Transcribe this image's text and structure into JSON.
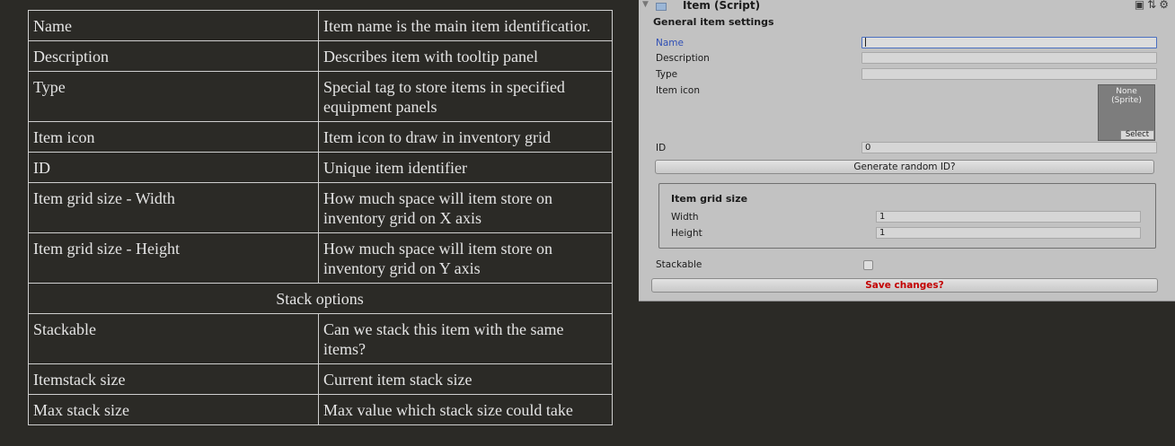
{
  "doc_table": {
    "rows": [
      {
        "name": "Name",
        "desc": "Item name is the main item identificatior."
      },
      {
        "name": "Description",
        "desc": "Describes item with tooltip panel"
      },
      {
        "name": "Type",
        "desc": "Special tag to store items in specified equipment panels"
      },
      {
        "name": "Item icon",
        "desc": "Item icon to draw in inventory grid"
      },
      {
        "name": "ID",
        "desc": "Unique item identifier"
      },
      {
        "name": "Item grid size - Width",
        "desc": "How much space will item store on inventory grid on X axis"
      },
      {
        "name": "Item grid size - Height",
        "desc": "How much space will item store on inventory grid on Y axis"
      }
    ],
    "section_header": "Stack options",
    "stack_rows": [
      {
        "name": "Stackable",
        "desc": "Can we stack this item with the same items?"
      },
      {
        "name": "Itemstack size",
        "desc": "Current item stack size"
      },
      {
        "name": "Max stack size",
        "desc": "Max value which stack size could take"
      }
    ]
  },
  "inspector": {
    "title": "Item (Script)",
    "fold_icon": "triangle-down-icon",
    "header_icons": [
      "book-icon",
      "sliders-icon",
      "gear-icon"
    ],
    "section_title": "General item settings",
    "fields": {
      "name_label": "Name",
      "name_value": "",
      "description_label": "Description",
      "description_value": "",
      "type_label": "Type",
      "type_value": "",
      "icon_label": "Item icon",
      "icon_none_text": "None\n(Sprite)",
      "icon_select_label": "Select",
      "id_label": "ID",
      "id_value": "0"
    },
    "generate_button": "Generate random ID?",
    "grid_group": {
      "title": "Item grid size",
      "width_label": "Width",
      "width_value": "1",
      "height_label": "Height",
      "height_value": "1"
    },
    "stackable_label": "Stackable",
    "stackable_checked": false,
    "save_button": "Save changes?",
    "colors": {
      "save_text": "#c30000",
      "active_label": "#2f4fb5",
      "panel_bg": "#c2c2c2"
    }
  }
}
